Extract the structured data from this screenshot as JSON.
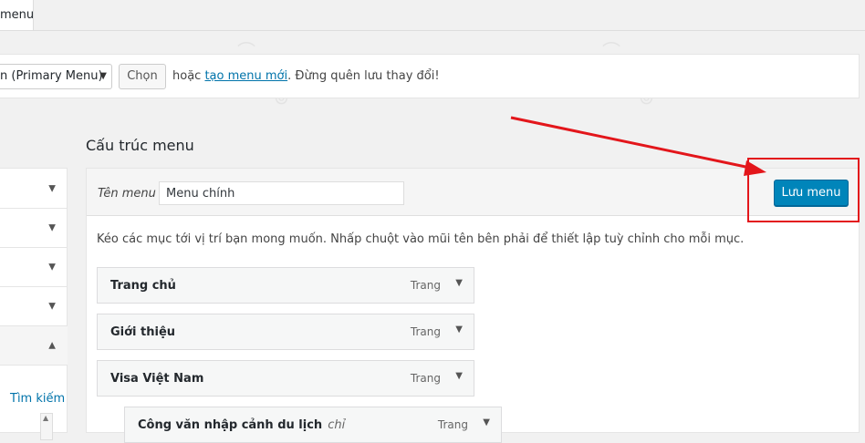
{
  "tabs": {
    "current_label": "menu"
  },
  "select_bar": {
    "menu_select_value": "n (Primary Menu)",
    "select_button_label": "Chọn",
    "text_or": "hoặc",
    "create_link": "tạo menu mới",
    "text_tail": ". Đừng quên lưu thay đổi!"
  },
  "left_panel": {
    "search_link": "Tìm kiếm"
  },
  "menu_structure": {
    "title": "Cấu trúc menu",
    "name_label": "Tên menu",
    "name_value": "Menu chính",
    "save_label": "Lưu menu",
    "instructions": "Kéo các mục tới vị trí bạn mong muốn. Nhấp chuột vào mũi tên bên phải để thiết lập tuỳ chỉnh cho mỗi mục.",
    "items": [
      {
        "title": "Trang chủ",
        "type": "Trang"
      },
      {
        "title": "Giới thiệu",
        "type": "Trang"
      },
      {
        "title": "Visa Việt Nam",
        "type": "Trang"
      },
      {
        "title": "Công văn nhập cảnh du lịch",
        "subtitle": "chỉ",
        "type": "Trang"
      }
    ]
  },
  "icons": {
    "dropdown": "triangle-down",
    "expand": "triangle-up",
    "annotation": "red-arrow"
  },
  "colors": {
    "accent": "#0085ba",
    "link": "#0073aa",
    "annotation": "#e3161b"
  }
}
